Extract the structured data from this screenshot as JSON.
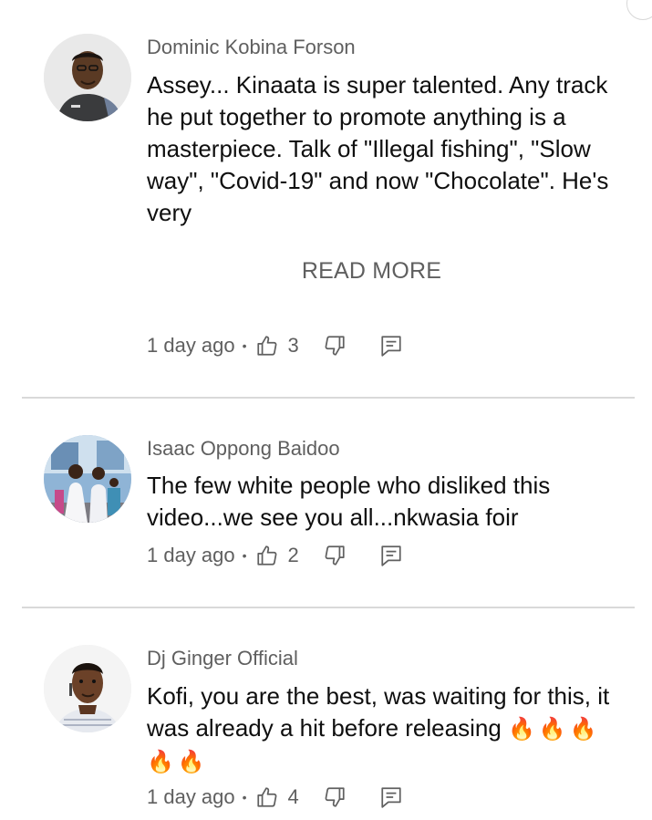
{
  "comments": [
    {
      "author": "Dominic Kobina Forson",
      "text": "Assey... Kinaata is super talented. Any track he put together to promote anything is a masterpiece. Talk of \"Illegal fishing\", \"Slow way\", \"Covid-19\" and now \"Chocolate\". He's very",
      "read_more": "READ MORE",
      "time": "1 day ago",
      "likes": "3"
    },
    {
      "author": "Isaac Oppong Baidoo",
      "text": "The few white people who disliked this video...we see you all...nkwasia foir",
      "time": "1 day ago",
      "likes": "2"
    },
    {
      "author": "Dj Ginger Official",
      "text": "Kofi, you are the best, was waiting for this, it was already a hit before releasing",
      "emoji": "🔥🔥🔥🔥🔥",
      "time": "1 day ago",
      "likes": "4"
    }
  ],
  "separator": "•",
  "icons": {
    "like": "thumbs-up-icon",
    "dislike": "thumbs-down-icon",
    "reply": "reply-comment-icon"
  },
  "colors": {
    "secondary_text": "#5f5f5f",
    "primary_text": "#0f0f0f",
    "divider": "#d9d9d9"
  }
}
